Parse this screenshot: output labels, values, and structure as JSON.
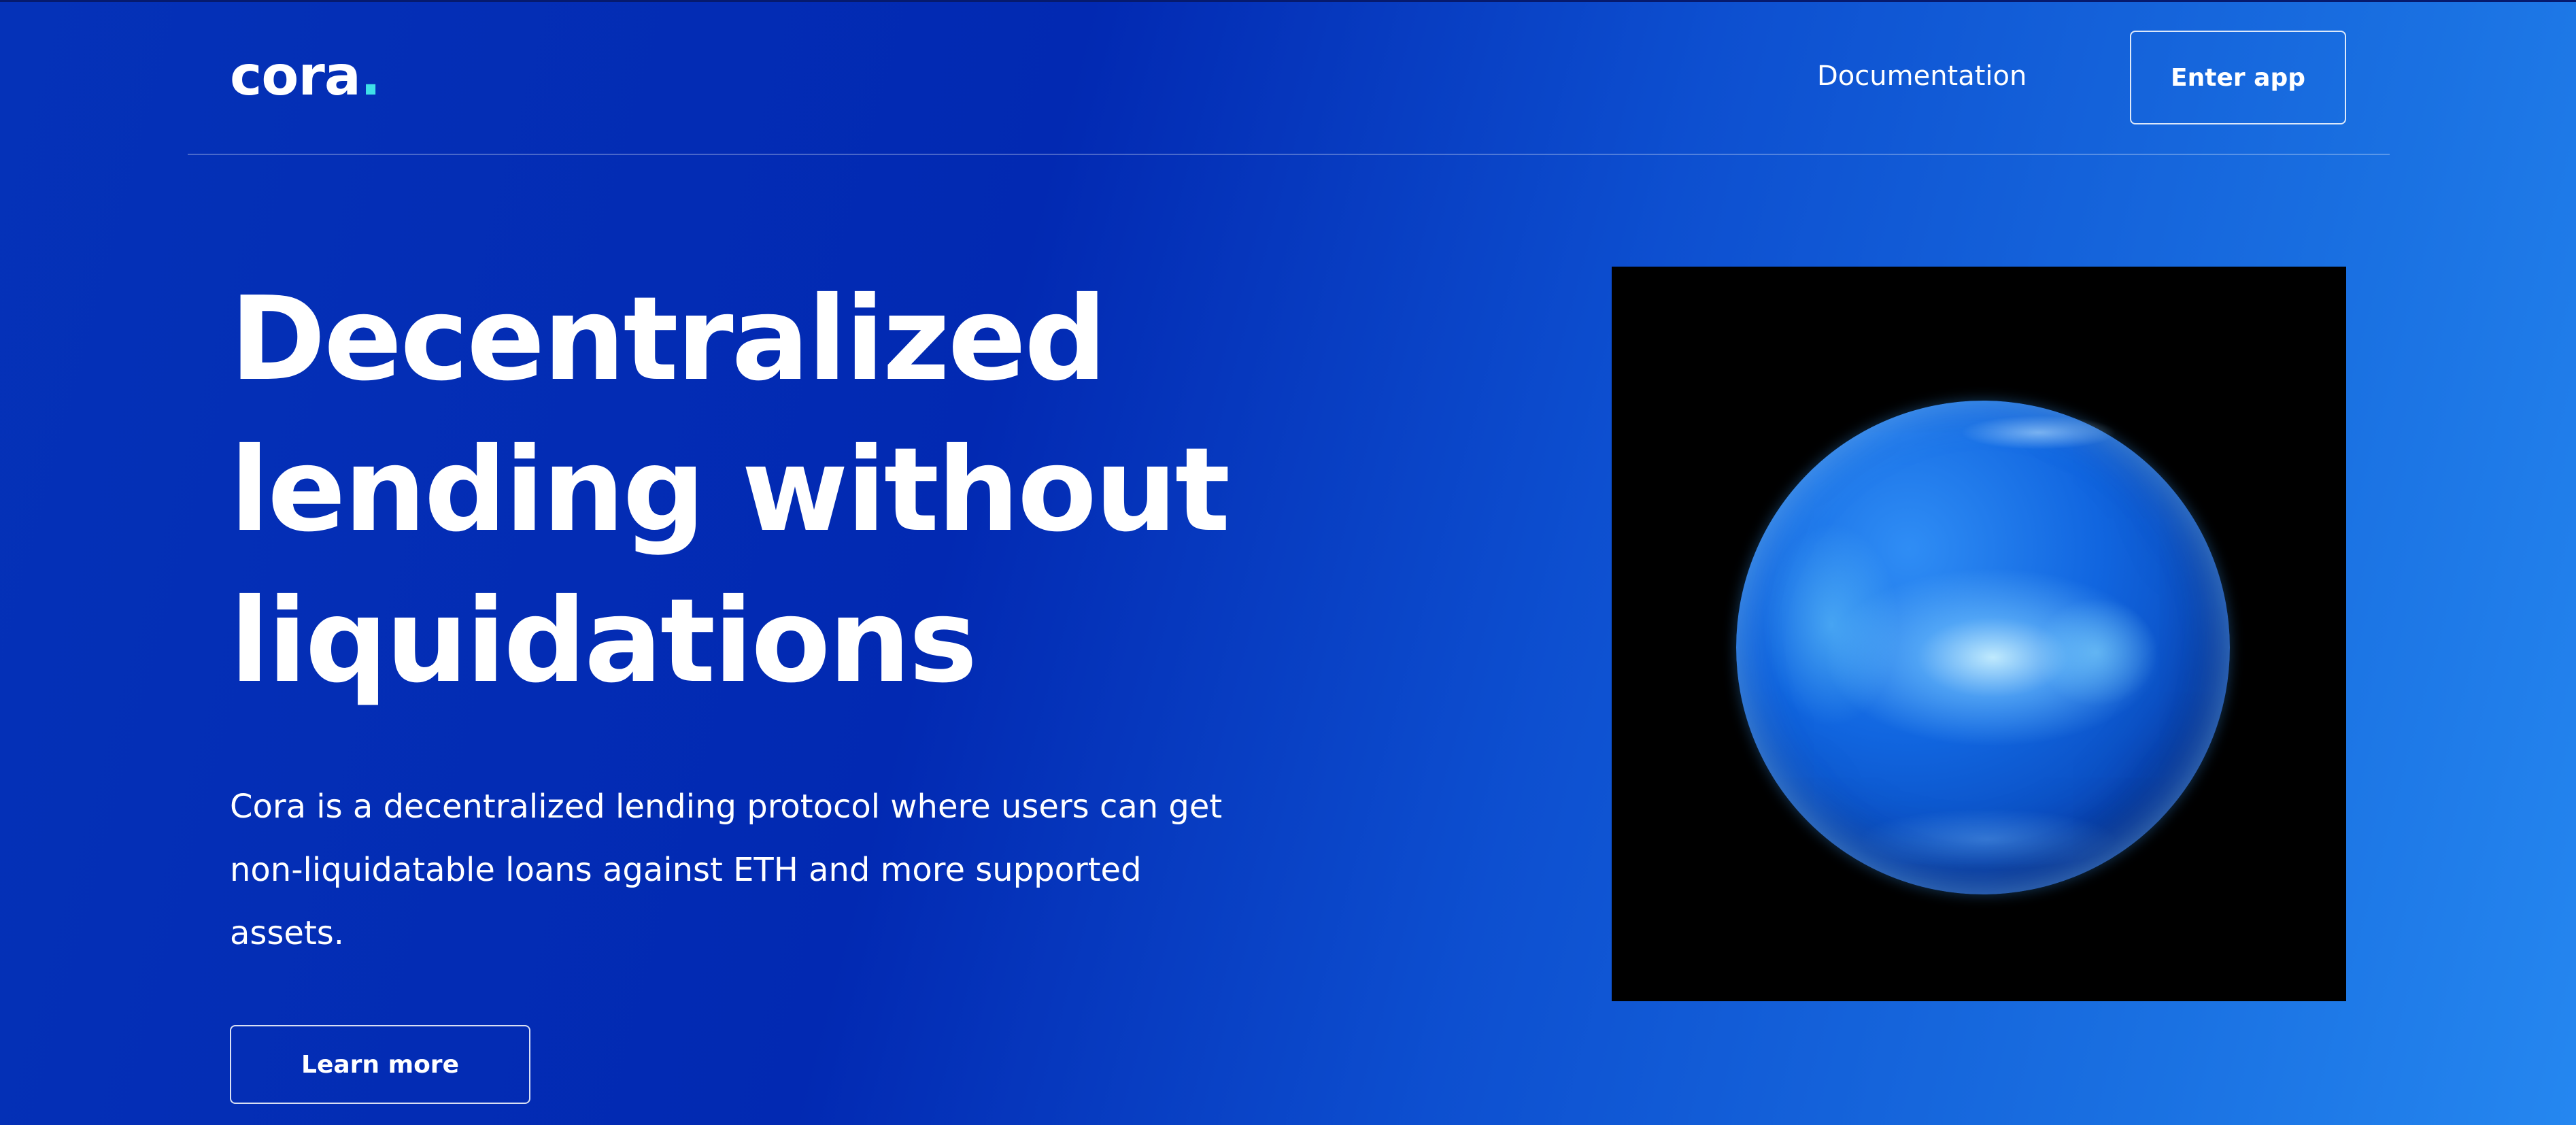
{
  "header": {
    "logo_text": "cora",
    "logo_dot": ".",
    "nav_docs_label": "Documentation",
    "enter_app_label": "Enter app"
  },
  "hero": {
    "headline_line1": "Decentralized",
    "headline_line2": "lending without",
    "headline_line3": "liquidations",
    "description_line1": "Cora is a decentralized lending protocol where users can get",
    "description_line2": "non-liquidatable loans against ETH and more supported",
    "description_line3": "assets.",
    "learn_more_label": "Learn more"
  },
  "colors": {
    "background_start": "#0532b8",
    "background_end": "#2587f0",
    "logo_accent": "#3fe0e8",
    "image_panel": "#000000"
  },
  "icons": {
    "hero_image": "blue-glass-sphere"
  }
}
